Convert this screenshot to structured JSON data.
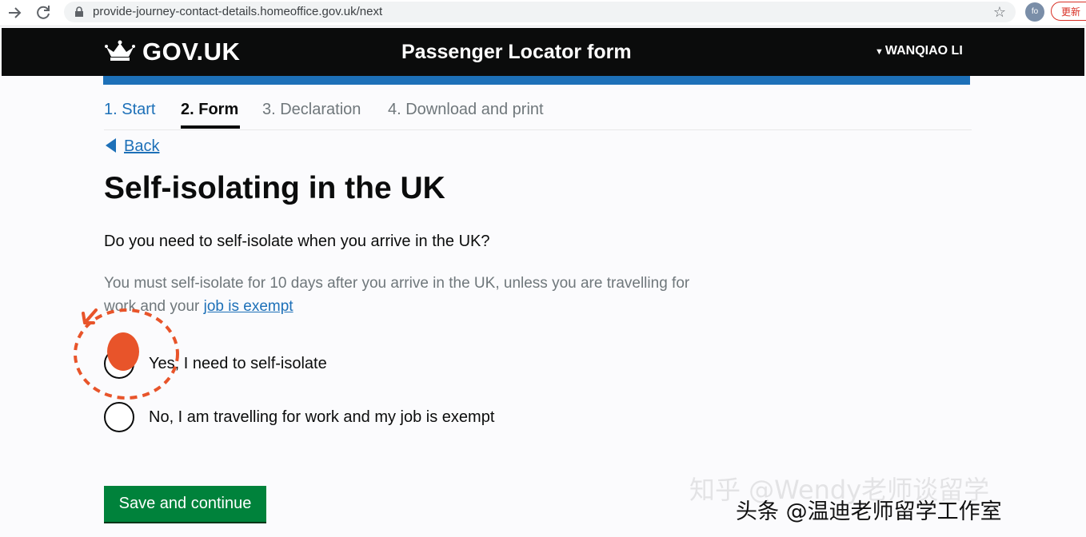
{
  "browser": {
    "url": "provide-journey-contact-details.homeoffice.gov.uk/next",
    "profile_initials": "fo",
    "update_label": "更新"
  },
  "header": {
    "logo_text": "GOV.UK",
    "service_name": "Passenger Locator form",
    "user_name": "WANQIAO LI"
  },
  "steps": [
    {
      "label": "1. Start",
      "state": "link"
    },
    {
      "label": "2. Form",
      "state": "current"
    },
    {
      "label": "3. Declaration",
      "state": "upcoming"
    },
    {
      "label": "4. Download and print",
      "state": "upcoming"
    }
  ],
  "back_label": "Back",
  "page_title": "Self-isolating in the UK",
  "question": "Do you need to self-isolate when you arrive in the UK?",
  "hint": {
    "text": "You must self-isolate for 10 days after you arrive in the UK, unless you are travelling for work and your",
    "link": "job is exempt"
  },
  "options": [
    {
      "label": "Yes, I need to self-isolate",
      "selected": false
    },
    {
      "label": "No, I am travelling for work and my job is exempt",
      "selected": false
    }
  ],
  "submit_label": "Save and continue",
  "watermarks": [
    "知乎 @Wendy老师谈留学",
    "头条 @温迪老师留学工作室"
  ],
  "colors": {
    "header_bg": "#0b0c0c",
    "link_blue": "#1d70b8",
    "button_green": "#00823b",
    "annotation_red": "#e8542a"
  }
}
